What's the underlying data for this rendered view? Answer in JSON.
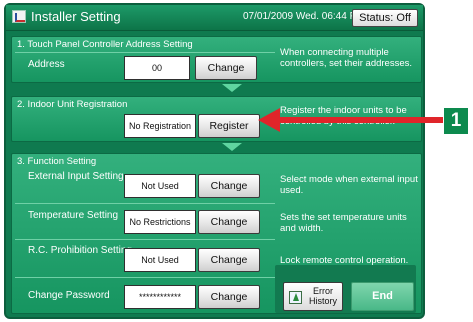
{
  "titlebar": {
    "title": "Installer Setting",
    "datetime": "07/01/2009 Wed. 06:44 PM",
    "status_label": "Status: Off"
  },
  "section1": {
    "heading": "1. Touch Panel Controller Address Setting",
    "row_label": "Address",
    "value": "00",
    "button": "Change",
    "description": "When connecting multiple controllers, set their addresses."
  },
  "section2": {
    "heading": "2. Indoor Unit Registration",
    "value": "No Registration",
    "button": "Register",
    "description": "Register the indoor units to be controlled by this controller."
  },
  "section3": {
    "heading": "3. Function Setting",
    "rows": [
      {
        "label": "External Input Setting",
        "value": "Not Used",
        "button": "Change",
        "description": "Select mode when external input used."
      },
      {
        "label": "Temperature Setting",
        "value": "No Restrictions",
        "button": "Change",
        "description": "Sets the set temperature units and width."
      },
      {
        "label": "R.C. Prohibition Setting",
        "value": "Not Used",
        "button": "Change",
        "description": "Lock remote control operation."
      },
      {
        "label": "Change Password",
        "value": "************",
        "button": "Change"
      }
    ]
  },
  "bottom": {
    "error_history": "Error History",
    "end": "End"
  },
  "callout": {
    "number": "1",
    "color": "#e0252a"
  },
  "icons": {
    "title": "installer-setting-icon",
    "error": "error-history-icon"
  }
}
